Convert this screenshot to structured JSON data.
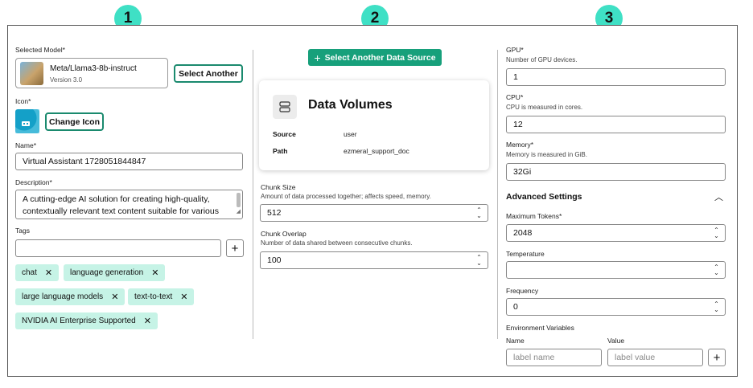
{
  "badges": [
    "1",
    "2",
    "3"
  ],
  "col1": {
    "selected_model_label": "Selected Model",
    "model_name": "Meta/Llama3-8b-instruct",
    "model_version": "Version 3.0",
    "select_another_label": "Select Another",
    "icon_label": "Icon",
    "change_icon_label": "Change Icon",
    "name_label": "Name",
    "name_value": "Virtual Assistant 1728051844847",
    "description_label": "Description",
    "description_line1": "A cutting-edge AI solution for creating high-quality,",
    "description_line2": "contextually relevant text content suitable for various",
    "tags_label": "Tags",
    "tags_input_value": "",
    "add_tag_label": "+",
    "tags": [
      "chat",
      "language generation",
      "large language models",
      "text-to-text",
      "NVIDIA AI Enterprise Supported"
    ],
    "chip_remove": "✕"
  },
  "col2": {
    "select_source_label": "Select Another Data Source",
    "card_title": "Data Volumes",
    "source_key": "Source",
    "source_value": "user",
    "path_key": "Path",
    "path_value": "ezmeral_support_doc",
    "chunk_size_label": "Chunk Size",
    "chunk_size_help": "Amount of data processed together; affects speed, memory.",
    "chunk_size_value": "512",
    "chunk_overlap_label": "Chunk Overlap",
    "chunk_overlap_help": "Number of data shared between consecutive chunks.",
    "chunk_overlap_value": "100"
  },
  "col3": {
    "gpu_label": "GPU",
    "gpu_help": "Number of GPU devices.",
    "gpu_value": "1",
    "cpu_label": "CPU",
    "cpu_help": "CPU is measured in cores.",
    "cpu_value": "12",
    "memory_label": "Memory",
    "memory_help": "Memory is measured in GiB.",
    "memory_value": "32Gi",
    "advanced_settings_label": "Advanced Settings",
    "max_tokens_label": "Maximum Tokens",
    "max_tokens_value": "2048",
    "temperature_label": "Temperature",
    "temperature_value": "",
    "frequency_label": "Frequency",
    "frequency_value": "0",
    "env_vars_label": "Environment Variables",
    "env_name_header": "Name",
    "env_value_header": "Value",
    "env_name_placeholder": "label name",
    "env_value_placeholder": "label value",
    "add_env_label": "+"
  },
  "required_mark": "*",
  "colors": {
    "accent": "#17a07b",
    "badge": "#3fe0c5",
    "chip": "#c6f3e6",
    "icon_tile": "#14a0c8"
  }
}
